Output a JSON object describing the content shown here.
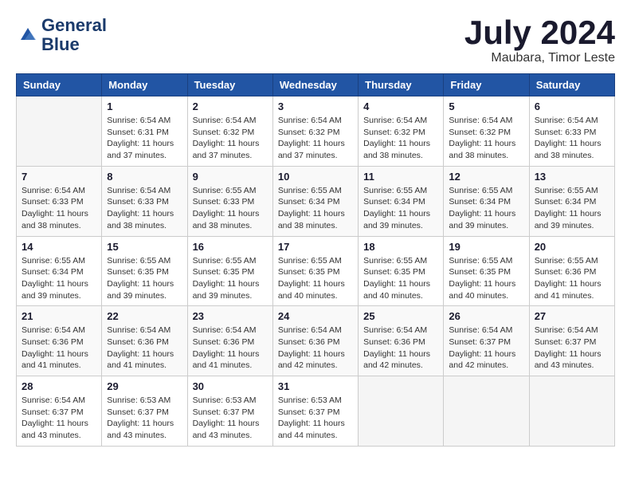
{
  "logo": {
    "line1": "General",
    "line2": "Blue"
  },
  "title": "July 2024",
  "subtitle": "Maubara, Timor Leste",
  "days_of_week": [
    "Sunday",
    "Monday",
    "Tuesday",
    "Wednesday",
    "Thursday",
    "Friday",
    "Saturday"
  ],
  "weeks": [
    [
      {
        "day": "",
        "info": ""
      },
      {
        "day": "1",
        "info": "Sunrise: 6:54 AM\nSunset: 6:31 PM\nDaylight: 11 hours and 37 minutes."
      },
      {
        "day": "2",
        "info": "Sunrise: 6:54 AM\nSunset: 6:32 PM\nDaylight: 11 hours and 37 minutes."
      },
      {
        "day": "3",
        "info": "Sunrise: 6:54 AM\nSunset: 6:32 PM\nDaylight: 11 hours and 37 minutes."
      },
      {
        "day": "4",
        "info": "Sunrise: 6:54 AM\nSunset: 6:32 PM\nDaylight: 11 hours and 38 minutes."
      },
      {
        "day": "5",
        "info": "Sunrise: 6:54 AM\nSunset: 6:32 PM\nDaylight: 11 hours and 38 minutes."
      },
      {
        "day": "6",
        "info": "Sunrise: 6:54 AM\nSunset: 6:33 PM\nDaylight: 11 hours and 38 minutes."
      }
    ],
    [
      {
        "day": "7",
        "info": "Sunrise: 6:54 AM\nSunset: 6:33 PM\nDaylight: 11 hours and 38 minutes."
      },
      {
        "day": "8",
        "info": "Sunrise: 6:54 AM\nSunset: 6:33 PM\nDaylight: 11 hours and 38 minutes."
      },
      {
        "day": "9",
        "info": "Sunrise: 6:55 AM\nSunset: 6:33 PM\nDaylight: 11 hours and 38 minutes."
      },
      {
        "day": "10",
        "info": "Sunrise: 6:55 AM\nSunset: 6:34 PM\nDaylight: 11 hours and 38 minutes."
      },
      {
        "day": "11",
        "info": "Sunrise: 6:55 AM\nSunset: 6:34 PM\nDaylight: 11 hours and 39 minutes."
      },
      {
        "day": "12",
        "info": "Sunrise: 6:55 AM\nSunset: 6:34 PM\nDaylight: 11 hours and 39 minutes."
      },
      {
        "day": "13",
        "info": "Sunrise: 6:55 AM\nSunset: 6:34 PM\nDaylight: 11 hours and 39 minutes."
      }
    ],
    [
      {
        "day": "14",
        "info": "Sunrise: 6:55 AM\nSunset: 6:34 PM\nDaylight: 11 hours and 39 minutes."
      },
      {
        "day": "15",
        "info": "Sunrise: 6:55 AM\nSunset: 6:35 PM\nDaylight: 11 hours and 39 minutes."
      },
      {
        "day": "16",
        "info": "Sunrise: 6:55 AM\nSunset: 6:35 PM\nDaylight: 11 hours and 39 minutes."
      },
      {
        "day": "17",
        "info": "Sunrise: 6:55 AM\nSunset: 6:35 PM\nDaylight: 11 hours and 40 minutes."
      },
      {
        "day": "18",
        "info": "Sunrise: 6:55 AM\nSunset: 6:35 PM\nDaylight: 11 hours and 40 minutes."
      },
      {
        "day": "19",
        "info": "Sunrise: 6:55 AM\nSunset: 6:35 PM\nDaylight: 11 hours and 40 minutes."
      },
      {
        "day": "20",
        "info": "Sunrise: 6:55 AM\nSunset: 6:36 PM\nDaylight: 11 hours and 41 minutes."
      }
    ],
    [
      {
        "day": "21",
        "info": "Sunrise: 6:54 AM\nSunset: 6:36 PM\nDaylight: 11 hours and 41 minutes."
      },
      {
        "day": "22",
        "info": "Sunrise: 6:54 AM\nSunset: 6:36 PM\nDaylight: 11 hours and 41 minutes."
      },
      {
        "day": "23",
        "info": "Sunrise: 6:54 AM\nSunset: 6:36 PM\nDaylight: 11 hours and 41 minutes."
      },
      {
        "day": "24",
        "info": "Sunrise: 6:54 AM\nSunset: 6:36 PM\nDaylight: 11 hours and 42 minutes."
      },
      {
        "day": "25",
        "info": "Sunrise: 6:54 AM\nSunset: 6:36 PM\nDaylight: 11 hours and 42 minutes."
      },
      {
        "day": "26",
        "info": "Sunrise: 6:54 AM\nSunset: 6:37 PM\nDaylight: 11 hours and 42 minutes."
      },
      {
        "day": "27",
        "info": "Sunrise: 6:54 AM\nSunset: 6:37 PM\nDaylight: 11 hours and 43 minutes."
      }
    ],
    [
      {
        "day": "28",
        "info": "Sunrise: 6:54 AM\nSunset: 6:37 PM\nDaylight: 11 hours and 43 minutes."
      },
      {
        "day": "29",
        "info": "Sunrise: 6:53 AM\nSunset: 6:37 PM\nDaylight: 11 hours and 43 minutes."
      },
      {
        "day": "30",
        "info": "Sunrise: 6:53 AM\nSunset: 6:37 PM\nDaylight: 11 hours and 43 minutes."
      },
      {
        "day": "31",
        "info": "Sunrise: 6:53 AM\nSunset: 6:37 PM\nDaylight: 11 hours and 44 minutes."
      },
      {
        "day": "",
        "info": ""
      },
      {
        "day": "",
        "info": ""
      },
      {
        "day": "",
        "info": ""
      }
    ]
  ]
}
